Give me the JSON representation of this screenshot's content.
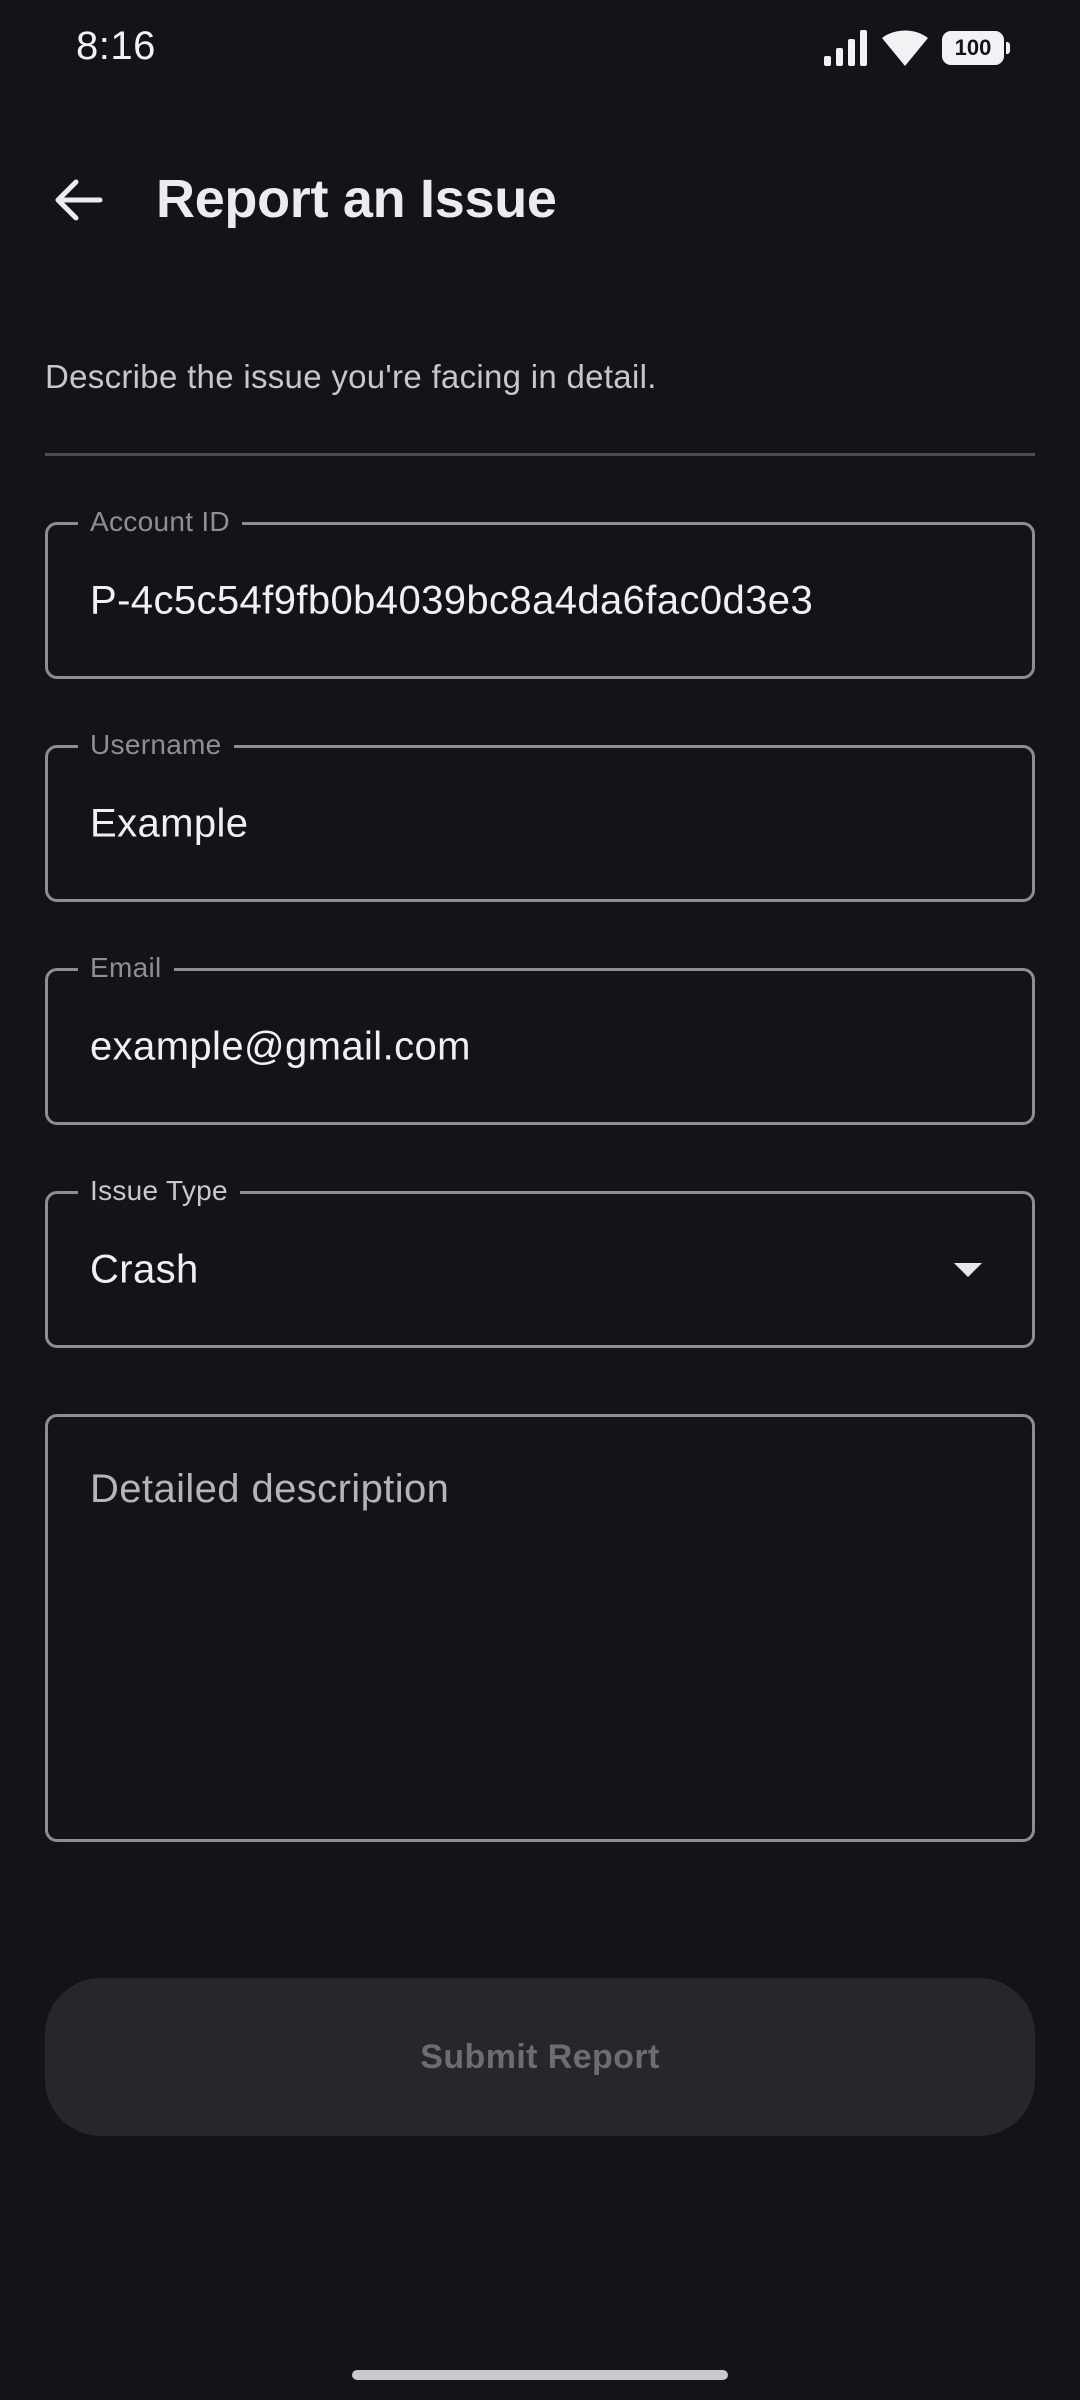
{
  "status_bar": {
    "time": "8:16",
    "battery": "100",
    "icons": [
      "signal-icon",
      "wifi-icon",
      "battery-icon"
    ]
  },
  "header": {
    "title": "Report an Issue",
    "back_icon": "arrow-left-icon"
  },
  "intro": "Describe the issue you're facing in detail.",
  "form": {
    "account_id": {
      "label": "Account ID",
      "value": "P-4c5c54f9fb0b4039bc8a4da6fac0d3e3"
    },
    "username": {
      "label": "Username",
      "value": "Example"
    },
    "email": {
      "label": "Email",
      "value": "example@gmail.com"
    },
    "issue_type": {
      "label": "Issue Type",
      "value": "Crash",
      "icon": "dropdown-arrow-icon"
    },
    "description": {
      "placeholder": "Detailed description"
    }
  },
  "submit": {
    "label": "Submit Report"
  },
  "colors": {
    "background": "#131419",
    "field_border": "#8d8d94",
    "button_bg": "#26272d",
    "button_text": "#6c6c72"
  }
}
